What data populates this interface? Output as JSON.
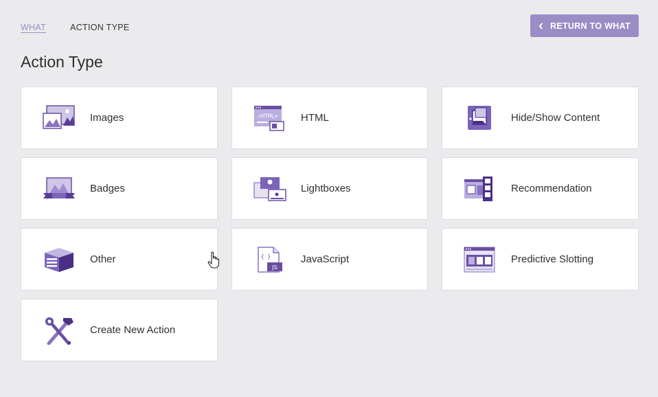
{
  "breadcrumb": {
    "link": "WHAT",
    "current": "ACTION TYPE"
  },
  "return_button": {
    "label": "RETURN TO WHAT",
    "icon": "chevron-left-icon"
  },
  "page_title": "Action Type",
  "accent_color": "#9a8dc6",
  "cards": [
    {
      "label": "Images",
      "icon": "images-icon"
    },
    {
      "label": "HTML",
      "icon": "html-icon"
    },
    {
      "label": "Hide/Show Content",
      "icon": "hide-show-content-icon"
    },
    {
      "label": "Badges",
      "icon": "badges-icon"
    },
    {
      "label": "Lightboxes",
      "icon": "lightboxes-icon"
    },
    {
      "label": "Recommendation",
      "icon": "recommendation-icon"
    },
    {
      "label": "Other",
      "icon": "other-box-icon"
    },
    {
      "label": "JavaScript",
      "icon": "javascript-file-icon"
    },
    {
      "label": "Predictive Slotting",
      "icon": "predictive-slotting-icon"
    },
    {
      "label": "Create New Action",
      "icon": "tools-icon"
    }
  ],
  "icon_text": {
    "html": "<HTML>",
    "js_braces": "{ }",
    "js": "JS"
  }
}
